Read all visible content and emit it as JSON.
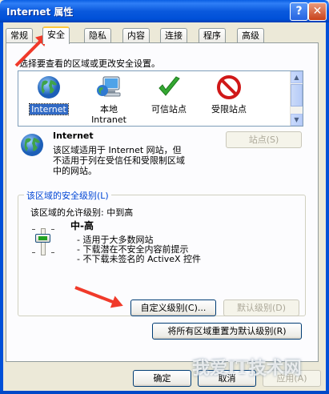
{
  "window": {
    "title": "Internet 属性",
    "help_glyph": "?",
    "close_glyph": "✕"
  },
  "tabs": [
    {
      "label": "常规"
    },
    {
      "label": "安全"
    },
    {
      "label": "隐私"
    },
    {
      "label": "内容"
    },
    {
      "label": "连接"
    },
    {
      "label": "程序"
    },
    {
      "label": "高级"
    }
  ],
  "active_tab": "安全",
  "security": {
    "prompt": "选择要查看的区域或更改安全设置。",
    "zones": [
      {
        "label": "Internet",
        "icon": "globe-icon",
        "selected": true
      },
      {
        "label": "本地\nIntranet",
        "icon": "computer-globe-icon",
        "selected": false
      },
      {
        "label": "可信站点",
        "icon": "checkmark-icon",
        "selected": false
      },
      {
        "label": "受限站点",
        "icon": "no-entry-icon",
        "selected": false
      }
    ],
    "zone_title": "Internet",
    "zone_desc": "该区域适用于 Internet 网站，但\n不适用于列在受信任和受限制区域\n中的网站。",
    "sites_button": "站点(S)",
    "level_group_label": "该区域的安全级别(L)",
    "allowed_levels": "该区域的允许级别: 中到高",
    "level_name": "中-高",
    "level_points": [
      "- 适用于大多数网站",
      "- 下载潜在不安全内容前提示",
      "- 不下载未签名的 ActiveX 控件"
    ],
    "slider_level": "中-高",
    "custom_button": "自定义级别(C)...",
    "default_button": "默认级别(D)",
    "reset_all_button": "将所有区域重置为默认级别(R)"
  },
  "footer": {
    "ok": "确定",
    "cancel": "取消",
    "apply": "应用(A)"
  },
  "watermark": "我爱IT技术网",
  "colors": {
    "titlebar": "#0a59dd",
    "selection": "#316ac5",
    "annotation_arrow": "#f03a2a",
    "legend_text": "#0046d5"
  }
}
